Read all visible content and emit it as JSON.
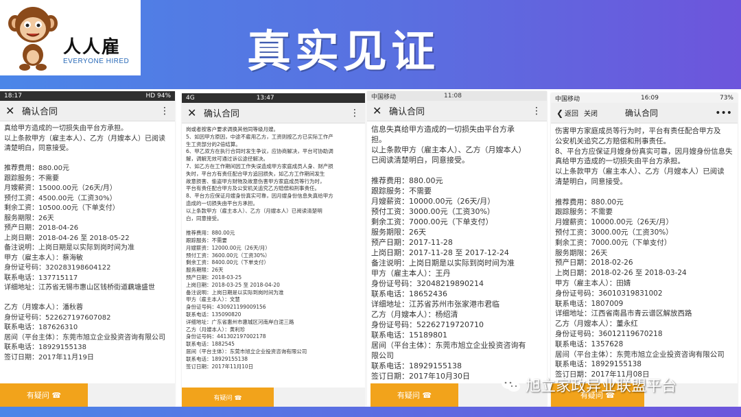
{
  "banner": {
    "title": "真实见证",
    "brand_cn": "人人雇",
    "brand_en": "EVERYONE HIRED"
  },
  "watermark": "旭立家政异业联盟平台",
  "phones": [
    {
      "status_left": "18:17",
      "status_right": "HD 94%",
      "header_title": "确认合同",
      "lines": [
        "真给甲方造成的一切损失由平台方承担。",
        "以上条款甲方（雇主本人）、乙方（月嫂本人）已阅读",
        "清楚明白，同意接受。",
        "",
        "推荐费用：880.00元",
        "跟踪服务：不需要",
        "月嫂薪资：15000.00元（26天/月）",
        "预付工资：4500.00元（工资30%）",
        "剩余工资：10500.00元（下单支付）",
        "服务期限：26天",
        "预产日期：2018-04-26",
        "上岗日期：2018-04-26 至 2018-05-22",
        "备注说明：上岗日期是以实际到岗时间为准",
        "甲方（雇主本人）：蔡海敏",
        "身份证号码：320283198604122",
        "联系电话：137715117",
        "详细地址：江苏省无锡市惠山区钱桥街道藕塘盛世",
        "",
        "乙方（月嫂本人）：潘秋蓉",
        "身份证号码：522627197607082",
        "联系电话：187626310",
        "居间（平台主体）：东莞市旭立企业投资咨询有限公司",
        "联系电话：18929155138",
        "签订日期：2017年11月19日"
      ],
      "button_label": "有疑问 ☎"
    },
    {
      "status_left": "4G",
      "status_center": "13:47",
      "header_title": "确认合同",
      "lines": [
        "岗或者按客户要求调换其他同等级月嫂。",
        "5、如因甲方原因，中途不雇用乙方，工资则按乙方已实际工作产",
        "生工资部分的2倍结算。",
        "6、甲乙双方在执行合同时发生争议，应协商解决，平台可协助调",
        "解，调解无效可通过诉讼途径解决。",
        "7、如乙方在工作期间因工作失误造成甲方家庭成员人身、财产损",
        "失时，平台方有责任配合甲方追回损失，如乙方工作期间发生",
        "故意损害、偷盗甲方财物及故意伤害甲方家庭成员等行为时，",
        "平台有责任配合甲方及公安机关追究乙方赔偿和刑事责任。",
        "8、平台方应保证月嫂身份真实可靠，因月嫂身份信息失真给甲方",
        "造成的一切损失由平台方承担。",
        "以上条款甲方（雇主本人）、乙方（月嫂本人）已阅读清楚明",
        "白，同意接受。",
        "",
        "推荐费用：880.00元",
        "跟踪服务：不需要",
        "月嫂薪资：12000.00元（26天/月）",
        "预付工资：3600.00元（工资30%）",
        "剩余工资：8400.00元（下单支付）",
        "服务期限：26天",
        "预产日期：2018-03-25",
        "上岗日期：2018-03-25 至 2018-04-20",
        "备注说明：上岗日期是以实际到岗时间为准",
        "甲方（雇主本人）：文慧",
        "身份证号码：430921199009156",
        "联系电话：135090820",
        "详细地址：广东省惠州市惠城区河南岸白泥三路",
        "乙方（月嫂本人）：黄利珍",
        "身份证号码：441302197002178",
        "联系电话：1882545",
        "居间（平台主体）：东莞市旭立企业投资咨询有限公司",
        "联系电话：18929155138",
        "签订日期：2017年11月10日"
      ],
      "button_label": "有疑问 ☎"
    },
    {
      "status_left": "中国移动",
      "status_center": "11:08",
      "header_title": "确认合同",
      "lines": [
        "信息失真给甲方造成的一切损失由平台方承",
        "担。",
        "以上条款甲方（雇主本人）、乙方（月嫂本人）",
        "已阅读清楚明白，同意接受。",
        "",
        "推荐费用：880.00元",
        "跟踪服务：不需要",
        "月嫂薪资：10000.00元（26天/月）",
        "预付工资：3000.00元（工资30%）",
        "剩余工资：7000.00元（下单支付）",
        "服务期限：26天",
        "预产日期：2017-11-28",
        "上岗日期：2017-11-28 至 2017-12-24",
        "备注说明：上岗日期是以实际到岗时间为准",
        "甲方（雇主本人）：王丹",
        "身份证号码：32048219890214",
        "联系电话：18652436",
        "详细地址：江苏省苏州市张家港市君临",
        "乙方（月嫂本人）：杨绍清",
        "身份证号码：52262719720710",
        "联系电话：15189801",
        "居间（平台主体）：东莞市旭立企业投资咨询有",
        "限公司",
        "联系电话：18929155138",
        "签订日期：2017年10月30日"
      ],
      "button_label": "有疑问 ☎"
    },
    {
      "status_left": "中国移动",
      "status_center": "16:09",
      "status_right": "73%",
      "back_label": "返回",
      "close_label": "关闭",
      "header_title": "确认合同",
      "lines": [
        "伤害甲方家庭成员等行为时，平台有责任配合甲方及",
        "公安机关追究乙方赔偿和刑事责任。",
        "8、平台方应保证月嫂身份真实可靠，因月嫂身份信息失",
        "真给甲方造成的一切损失由平台方承担。",
        "以上条款甲方（雇主本人）、乙方（月嫂本人）已阅读",
        "清楚明白，同意接受。",
        "",
        "推荐费用：880.00元",
        "跟踪服务：不需要",
        "月嫂薪资：10000.00元（26天/月）",
        "预付工资：3000.00元（工资30%）",
        "剩余工资：7000.00元（下单支付）",
        "服务期限：26天",
        "预产日期：2018-02-26",
        "上岗日期：2018-02-26 至 2018-03-24",
        "甲方（雇主本人）：田婧",
        "身份证号码：36010319831002",
        "联系电话：1807009",
        "详细地址：江西省南昌市青云谱区解放西路",
        "乙方（月嫂本人）：董永红",
        "身份证号码：36012119670218",
        "联系电话：1357628",
        "居间（平台主体）：东莞市旭立企业投资咨询有限公司",
        "联系电话：18929155138",
        "签订日期：2017年11月08日"
      ],
      "button_label": "有疑问 ☎"
    }
  ],
  "colors": {
    "banner_start": "#4b86e8",
    "banner_end": "#6d55dc",
    "button": "#f2a31b"
  }
}
